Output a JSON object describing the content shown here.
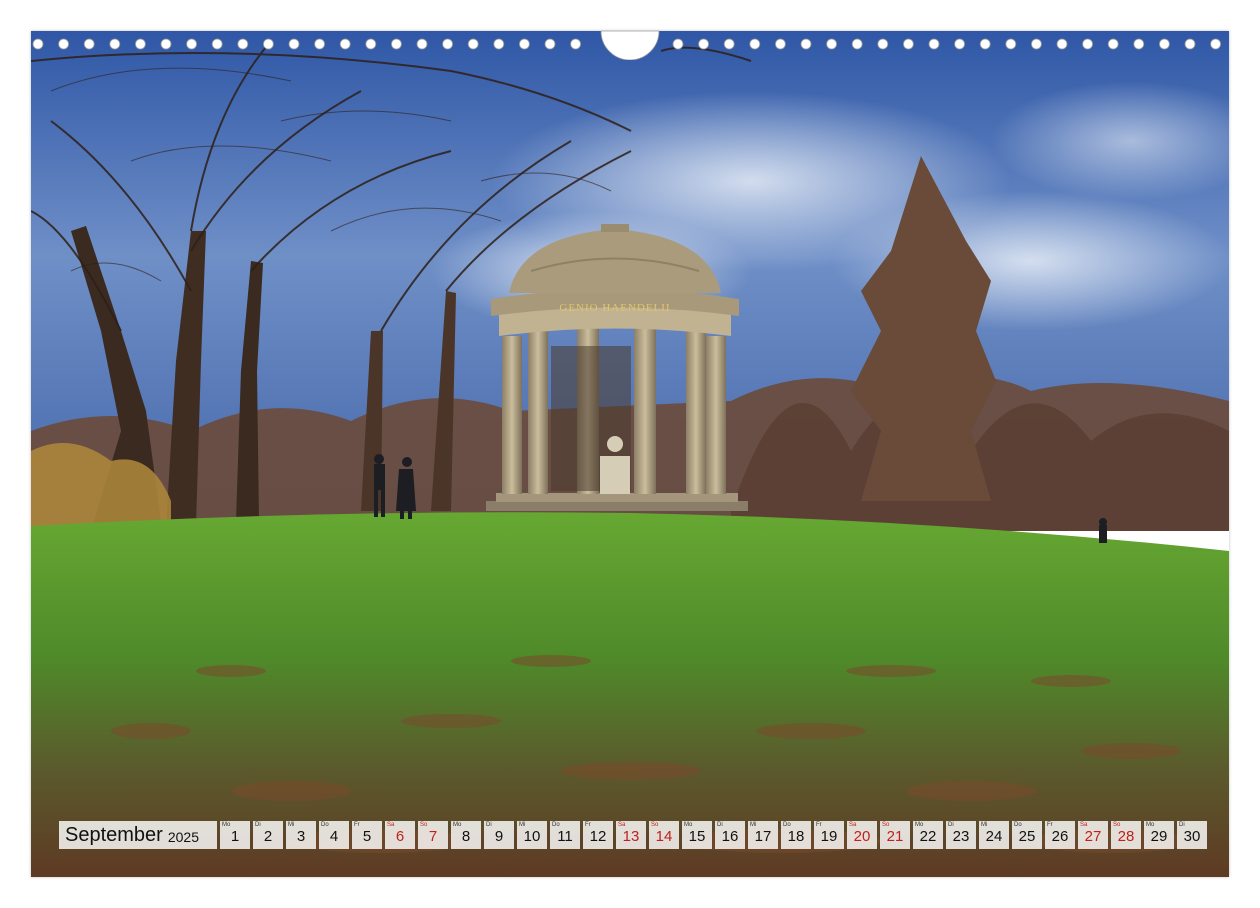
{
  "calendar": {
    "month": "September",
    "year": "2025",
    "days": [
      {
        "wd": "Mo",
        "num": "1",
        "weekend": false
      },
      {
        "wd": "Di",
        "num": "2",
        "weekend": false
      },
      {
        "wd": "Mi",
        "num": "3",
        "weekend": false
      },
      {
        "wd": "Do",
        "num": "4",
        "weekend": false
      },
      {
        "wd": "Fr",
        "num": "5",
        "weekend": false
      },
      {
        "wd": "Sa",
        "num": "6",
        "weekend": true
      },
      {
        "wd": "So",
        "num": "7",
        "weekend": true
      },
      {
        "wd": "Mo",
        "num": "8",
        "weekend": false
      },
      {
        "wd": "Di",
        "num": "9",
        "weekend": false
      },
      {
        "wd": "Mi",
        "num": "10",
        "weekend": false
      },
      {
        "wd": "Do",
        "num": "11",
        "weekend": false
      },
      {
        "wd": "Fr",
        "num": "12",
        "weekend": false
      },
      {
        "wd": "Sa",
        "num": "13",
        "weekend": true
      },
      {
        "wd": "So",
        "num": "14",
        "weekend": true
      },
      {
        "wd": "Mo",
        "num": "15",
        "weekend": false
      },
      {
        "wd": "Di",
        "num": "16",
        "weekend": false
      },
      {
        "wd": "Mi",
        "num": "17",
        "weekend": false
      },
      {
        "wd": "Do",
        "num": "18",
        "weekend": false
      },
      {
        "wd": "Fr",
        "num": "19",
        "weekend": false
      },
      {
        "wd": "Sa",
        "num": "20",
        "weekend": true
      },
      {
        "wd": "So",
        "num": "21",
        "weekend": true
      },
      {
        "wd": "Mo",
        "num": "22",
        "weekend": false
      },
      {
        "wd": "Di",
        "num": "23",
        "weekend": false
      },
      {
        "wd": "Mi",
        "num": "24",
        "weekend": false
      },
      {
        "wd": "Do",
        "num": "25",
        "weekend": false
      },
      {
        "wd": "Fr",
        "num": "26",
        "weekend": false
      },
      {
        "wd": "Sa",
        "num": "27",
        "weekend": true
      },
      {
        "wd": "So",
        "num": "28",
        "weekend": true
      },
      {
        "wd": "Mo",
        "num": "29",
        "weekend": false
      },
      {
        "wd": "Di",
        "num": "30",
        "weekend": false
      }
    ]
  },
  "photo": {
    "temple_inscription": "GENIO HAENDELII",
    "colors": {
      "sky": "#3a5fa8",
      "grass": "#5a9a2e",
      "stone": "#b8a98a",
      "weekend_red": "#c0201c"
    }
  }
}
